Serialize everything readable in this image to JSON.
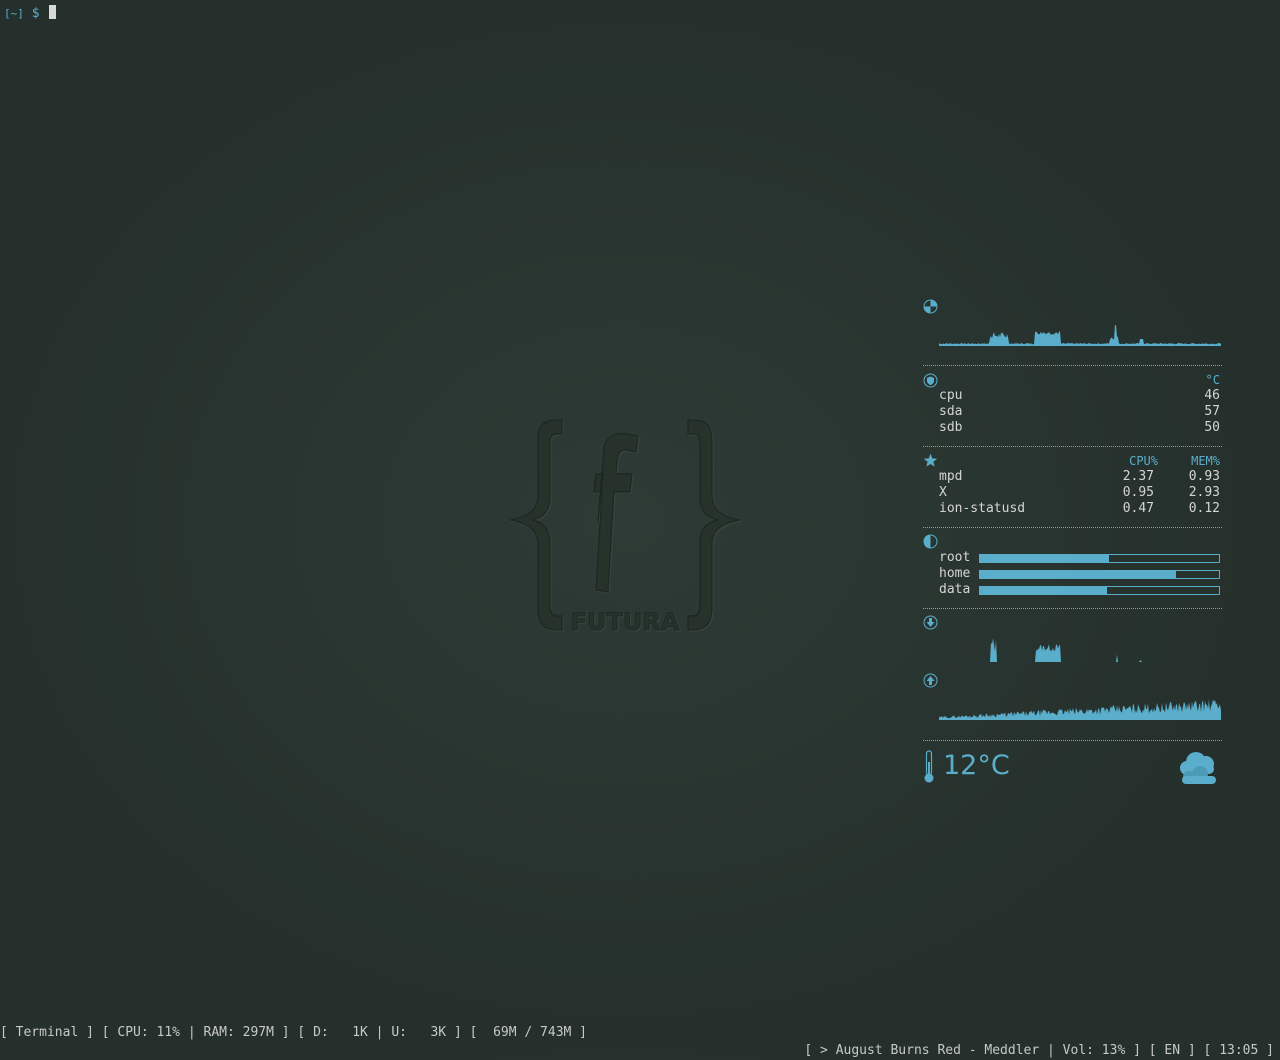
{
  "terminal": {
    "dir": "[~]",
    "prompt_symbol": "$"
  },
  "logo": {
    "text": "FUTURA",
    "glyph": "f"
  },
  "conky": {
    "cpu_graph_icon": "cpu-pie-icon",
    "temps": {
      "unit": "°C",
      "items": [
        {
          "label": "cpu",
          "value": "46"
        },
        {
          "label": "sda",
          "value": "57"
        },
        {
          "label": "sdb",
          "value": "50"
        }
      ]
    },
    "processes": {
      "cpu_header": "CPU%",
      "mem_header": "MEM%",
      "items": [
        {
          "name": "mpd",
          "cpu": "2.37",
          "mem": "0.93"
        },
        {
          "name": "X",
          "cpu": "0.95",
          "mem": "2.93"
        },
        {
          "name": "ion-statusd",
          "cpu": "0.47",
          "mem": "0.12"
        }
      ]
    },
    "disks": [
      {
        "label": "root",
        "usage": 0.54
      },
      {
        "label": "home",
        "usage": 0.82
      },
      {
        "label": "data",
        "usage": 0.53
      }
    ],
    "weather": {
      "temperature": "12°C",
      "icon": "cloud-icon"
    }
  },
  "statusbar": {
    "left": "[ Terminal ] [ CPU: 11% | RAM: 297M ] [ D:   1K | U:   3K ] [  69M / 743M ]",
    "right": "[ > August Burns Red - Meddler | Vol: 13% ] [ EN ] [ 13:05 ]"
  },
  "colors": {
    "accent": "#5aaecb",
    "background": "#2a3631"
  }
}
